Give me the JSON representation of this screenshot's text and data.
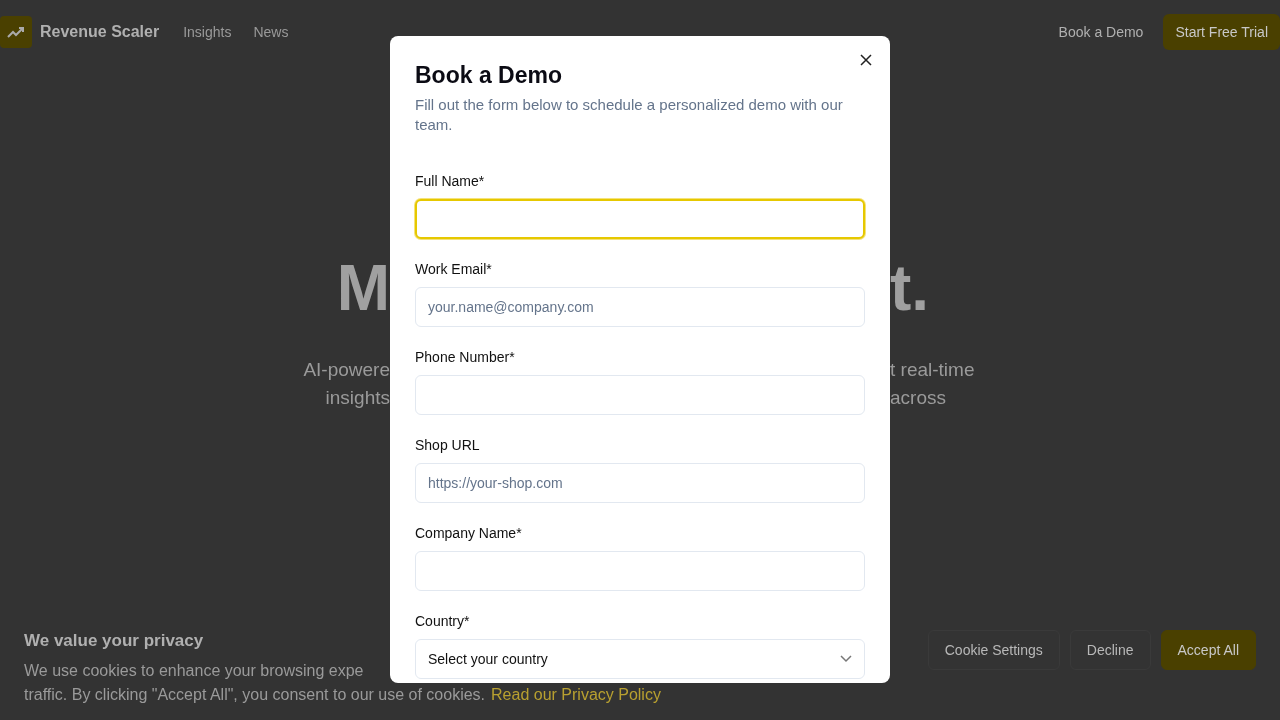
{
  "nav": {
    "brand": "Revenue Scaler",
    "links": [
      "Insights",
      "News"
    ],
    "book_demo": "Book a Demo",
    "trial": "Start Free Trial"
  },
  "hero": {
    "heading_left": "M",
    "heading_right": "t.",
    "text_left": [
      "AI-powere",
      "insights"
    ],
    "text_right": [
      "t real-time",
      "across"
    ]
  },
  "modal": {
    "title": "Book a Demo",
    "description": "Fill out the form below to schedule a personalized demo with our team.",
    "fields": [
      {
        "label": "Full Name*",
        "kind": "input",
        "focused": true
      },
      {
        "label": "Work Email*",
        "kind": "input",
        "placeholder": "your.name@company.com",
        "focused": false
      },
      {
        "label": "Phone Number*",
        "kind": "input",
        "focused": false
      },
      {
        "label": "Shop URL",
        "kind": "input",
        "placeholder": "https://your-shop.com",
        "focused": false
      },
      {
        "label": "Company Name*",
        "kind": "input",
        "focused": false
      },
      {
        "label": "Country*",
        "kind": "select",
        "value": "Select your country",
        "focused": false
      }
    ]
  },
  "cookie_banner": {
    "title": "We value your privacy",
    "line_1": "We use cookies to enhance your browsing expe",
    "line_2": "traffic. By clicking \"Accept All\", you consent to our use of cookies.",
    "link": "Read our Privacy Policy",
    "buttons": [
      {
        "label": "Cookie Settings",
        "kind": "plain"
      },
      {
        "label": "Decline",
        "kind": "plain"
      },
      {
        "label": "Accept All",
        "kind": "primary"
      }
    ]
  }
}
